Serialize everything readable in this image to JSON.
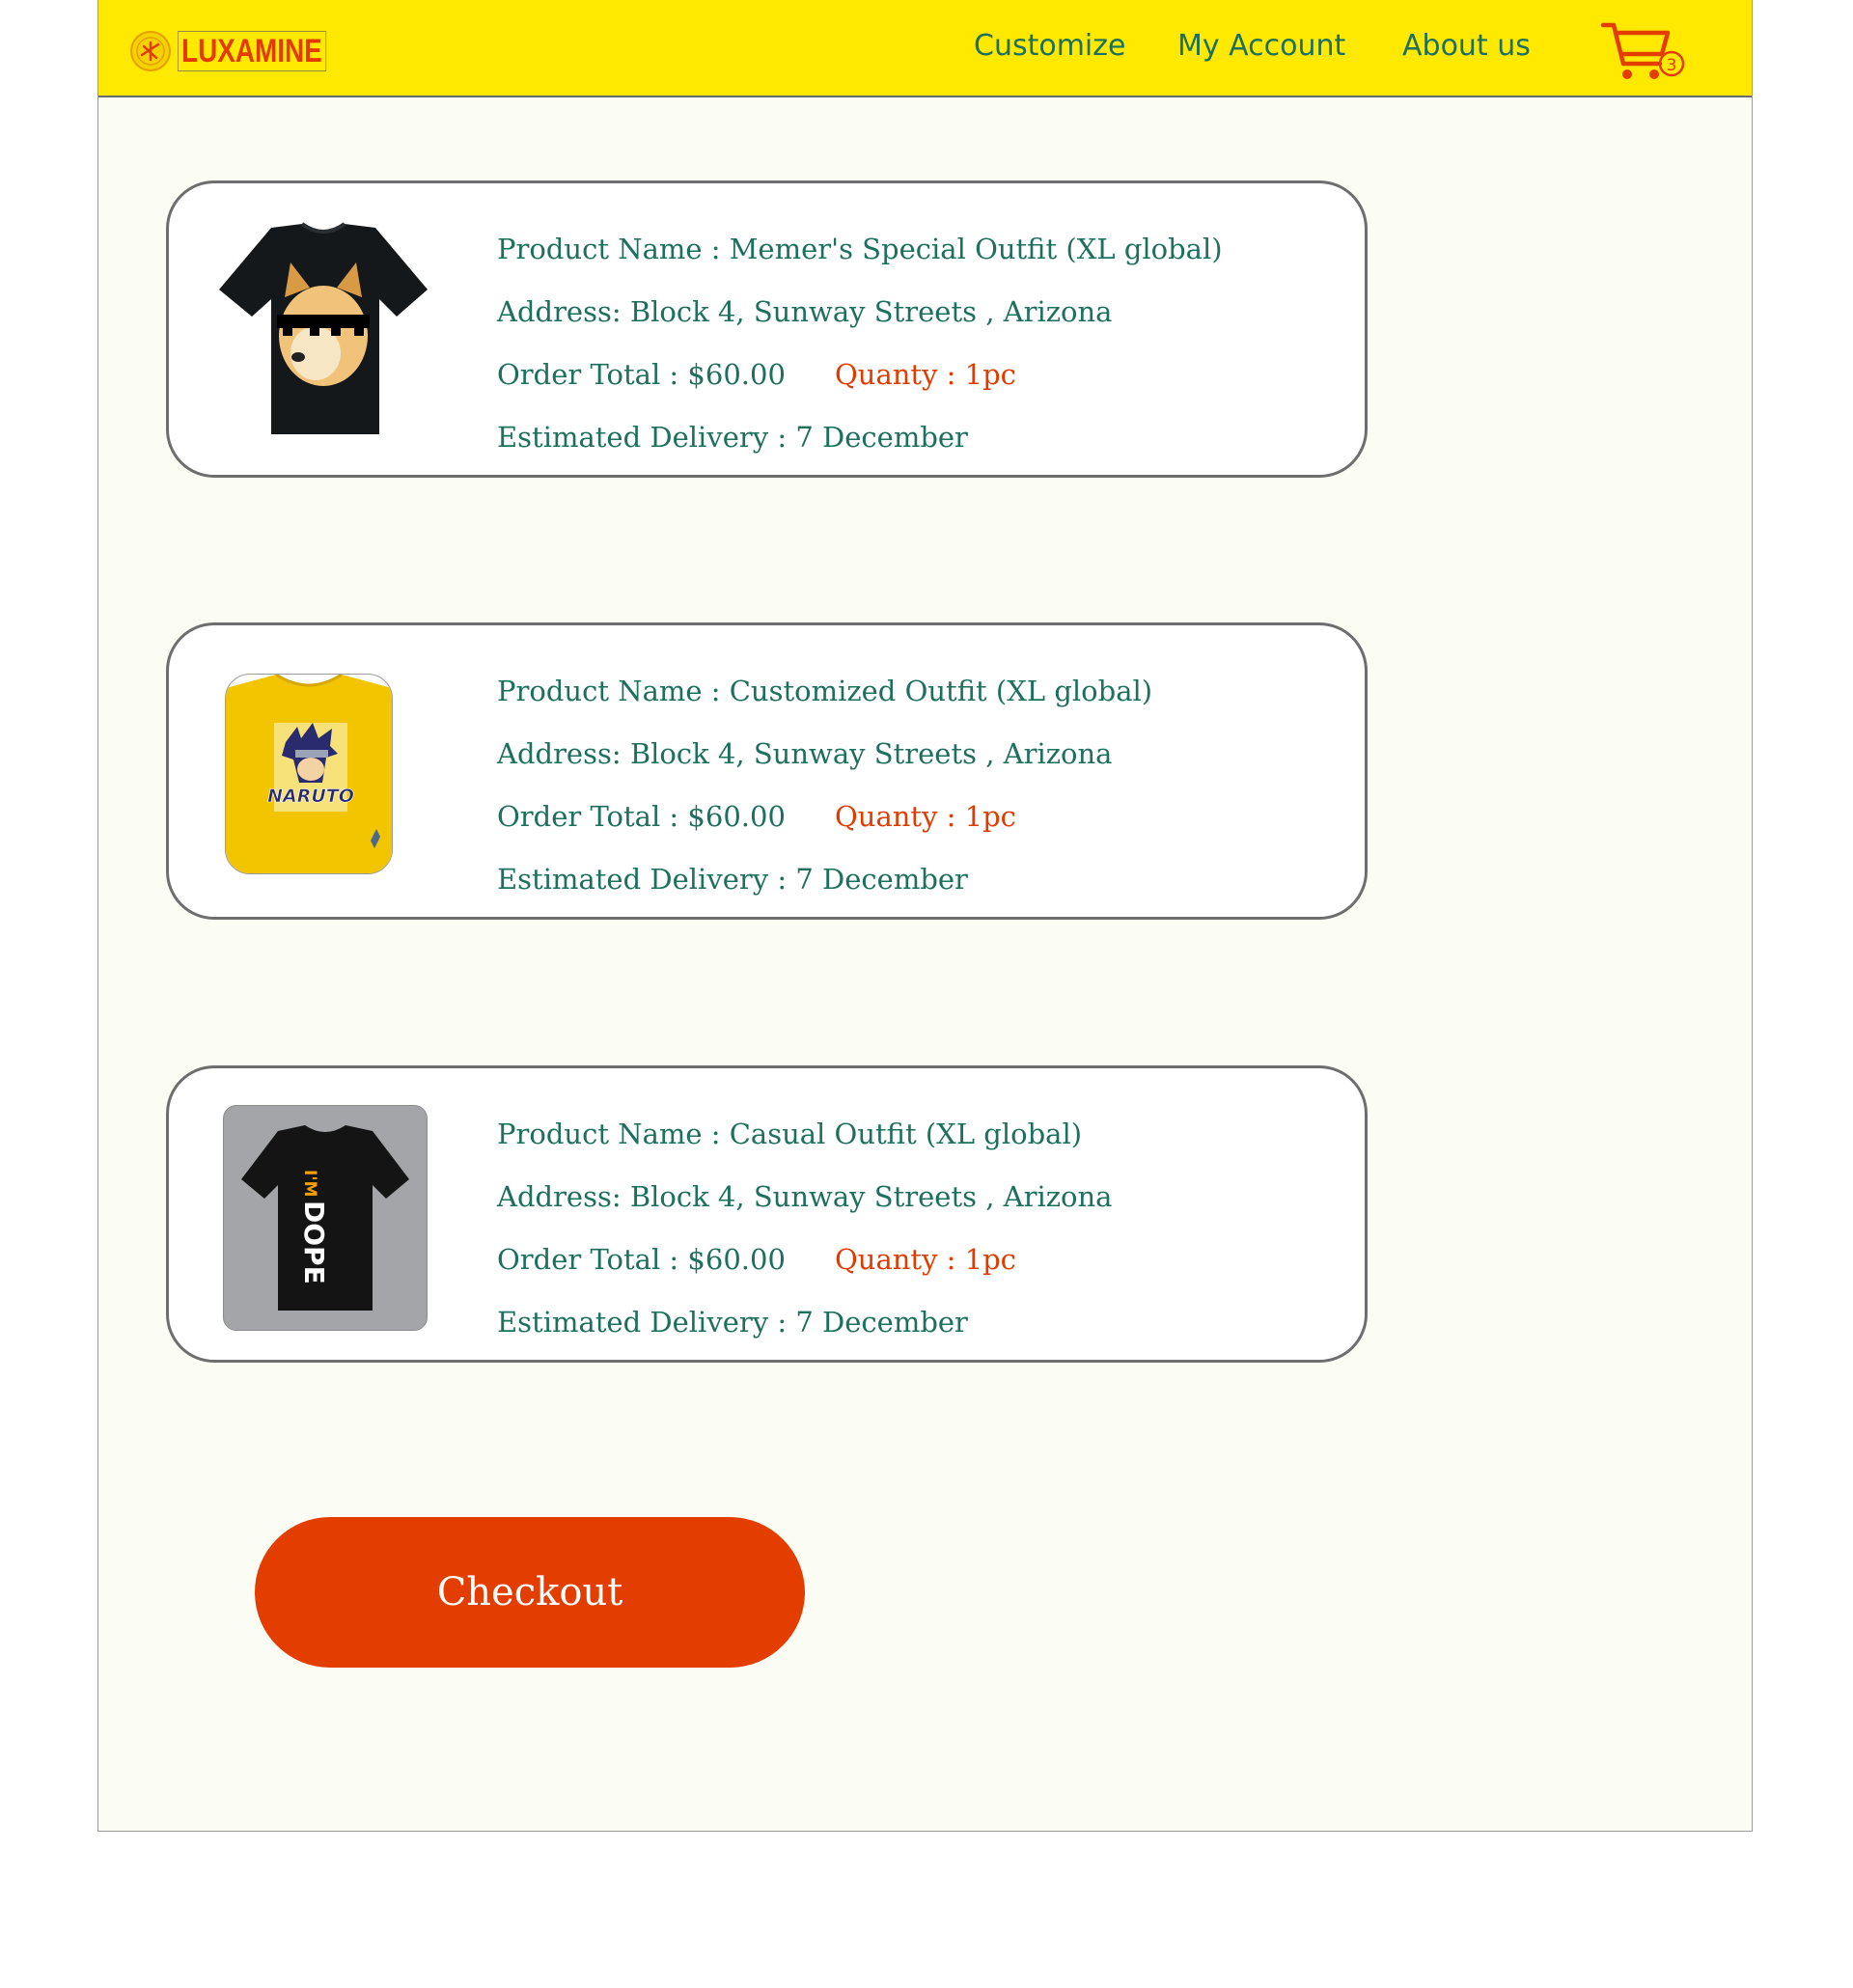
{
  "header": {
    "logo_text": "LUXAMINE",
    "nav": [
      "Customize",
      "My Account",
      "About us"
    ],
    "cart_count": "3",
    "cart_icon": "shopping-cart-icon"
  },
  "orders": [
    {
      "product": "Product Name : Memer's Special Outfit (XL global)",
      "address": "Address: Block 4, Sunway Streets , Arizona",
      "total": "Order Total : $60.00",
      "quantity": "Quanty : 1pc",
      "delivery": "Estimated Delivery : 7 December",
      "image": "black-doge-tshirt"
    },
    {
      "product": "Product Name : Customized Outfit (XL global)",
      "address": "Address: Block 4, Sunway Streets , Arizona",
      "total": "Order Total : $60.00",
      "quantity": "Quanty : 1pc",
      "delivery": "Estimated Delivery : 7 December",
      "image": "yellow-naruto-tshirt",
      "image_text": "NARUTO"
    },
    {
      "product": "Product Name : Casual  Outfit (XL global)",
      "address": "Address: Block 4, Sunway Streets , Arizona",
      "total": "Order Total : $60.00",
      "quantity": "Quanty : 1pc",
      "delivery": "Estimated Delivery : 7 December",
      "image": "black-im-dope-tshirt",
      "image_text_small": "I'M",
      "image_text": "DOPE"
    }
  ],
  "checkout_label": "Checkout",
  "colors": {
    "header_bg": "#ffe900",
    "accent": "#e33d00",
    "text": "#1d6f5e",
    "page_bg": "#fbfdf5"
  }
}
